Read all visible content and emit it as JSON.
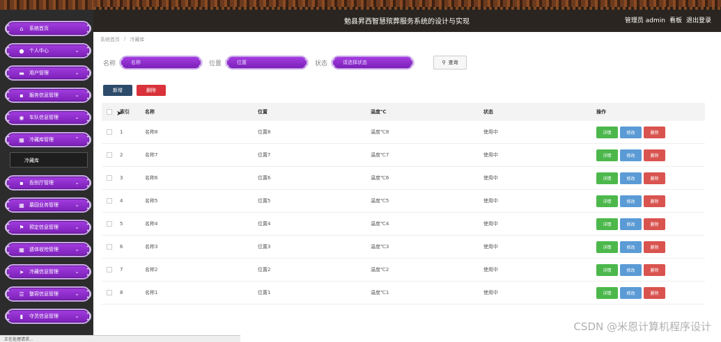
{
  "app": {
    "title": "勉县昇西智慧殡葬服务系统的设计与实现",
    "user": "管理员 admin",
    "board_link": "看板",
    "logout_link": "退出登录"
  },
  "sidebar": {
    "items": [
      {
        "label": "系统首页",
        "icon": "home-icon"
      },
      {
        "label": "个人中心",
        "icon": "user-icon"
      },
      {
        "label": "用户管理",
        "icon": "briefcase-icon"
      },
      {
        "label": "服务信息管理",
        "icon": "message-icon"
      },
      {
        "label": "车队信息管理",
        "icon": "location-icon"
      },
      {
        "label": "冷藏库管理",
        "icon": "grid-icon"
      },
      {
        "label": "告别厅管理",
        "icon": "message-icon"
      },
      {
        "label": "墓园业务管理",
        "icon": "grid-icon"
      },
      {
        "label": "预定信息管理",
        "icon": "flag-icon"
      },
      {
        "label": "遗体收殓管理",
        "icon": "grid-icon"
      },
      {
        "label": "冷藏信息管理",
        "icon": "send-icon"
      },
      {
        "label": "整容信息管理",
        "icon": "list-icon"
      },
      {
        "label": "守灵信息管理",
        "icon": "chart-icon"
      }
    ],
    "submenu": "冷藏库"
  },
  "breadcrumb": {
    "home": "系统首页",
    "sep": "/",
    "current": "冷藏库"
  },
  "search": {
    "name_label": "名称",
    "name_placeholder": "名称",
    "pos_label": "位置",
    "pos_placeholder": "位置",
    "status_label": "状态",
    "status_placeholder": "请选择状态",
    "query_label": "查询"
  },
  "actions": {
    "add": "新增",
    "delete": "删除"
  },
  "table": {
    "headers": {
      "index": "索引",
      "name": "名称",
      "position": "位置",
      "temp": "温度℃",
      "status": "状态",
      "ops": "操作"
    },
    "ops": {
      "detail": "详情",
      "edit": "修改",
      "delete": "删除"
    },
    "rows": [
      {
        "index": "1",
        "name": "名称8",
        "position": "位置8",
        "temp": "温度℃8",
        "status": "使用中"
      },
      {
        "index": "2",
        "name": "名称7",
        "position": "位置7",
        "temp": "温度℃7",
        "status": "使用中"
      },
      {
        "index": "3",
        "name": "名称6",
        "position": "位置6",
        "temp": "温度℃6",
        "status": "使用中"
      },
      {
        "index": "4",
        "name": "名称5",
        "position": "位置5",
        "temp": "温度℃5",
        "status": "使用中"
      },
      {
        "index": "5",
        "name": "名称4",
        "position": "位置4",
        "temp": "温度℃4",
        "status": "使用中"
      },
      {
        "index": "6",
        "name": "名称3",
        "position": "位置3",
        "temp": "温度℃3",
        "status": "使用中"
      },
      {
        "index": "7",
        "name": "名称2",
        "position": "位置2",
        "temp": "温度℃2",
        "status": "使用中"
      },
      {
        "index": "8",
        "name": "名称1",
        "position": "位置1",
        "temp": "温度℃1",
        "status": "使用中"
      }
    ]
  },
  "watermark": "CSDN @米恩计算机程序设计",
  "statusbar": "正在处理请求..."
}
